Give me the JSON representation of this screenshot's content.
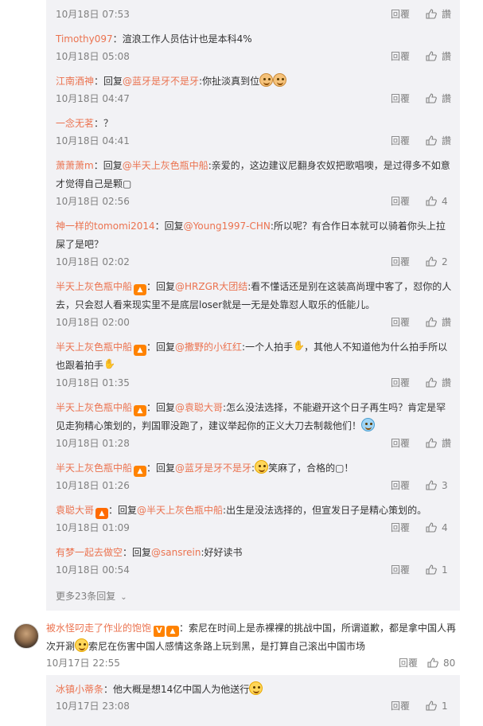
{
  "replies": [
    {
      "id": "r1",
      "time": "10月18日 07:53",
      "reply": "回覆",
      "likes": "讚"
    },
    {
      "id": "r2",
      "user": "Timothy097",
      "text": "：渲浪工作人员估计也是本科4%",
      "time": "10月18日 05:08",
      "reply": "回覆",
      "likes": "讚"
    },
    {
      "id": "r3",
      "user": "江南酒神",
      "prefix": "：回复",
      "at": "@蓝牙是牙不是牙",
      "text": ":你扯淡真到位",
      "time": "10月18日 04:47",
      "reply": "回覆",
      "likes": "讚"
    },
    {
      "id": "r4",
      "user": "一念无茗",
      "text": "：？",
      "time": "10月18日 04:41",
      "reply": "回覆",
      "likes": "讚"
    },
    {
      "id": "r5",
      "user": "萧萧萧m",
      "prefix": "：回复",
      "at": "@半天上灰色瓶中船",
      "text": ":亲爱的，这边建议尼翻身农奴把歌唱噢，是过得多不如意才觉得自己是颗▢",
      "time": "10月18日 02:56",
      "reply": "回覆",
      "likes": "4"
    },
    {
      "id": "r6",
      "user": "神一样的tomomi2014",
      "prefix": "：回复",
      "at": "@Young1997-CHN",
      "text": ":所以呢？有合作日本就可以骑着你头上拉屎了是吧？",
      "time": "10月18日 02:02",
      "reply": "回覆",
      "likes": "2"
    },
    {
      "id": "r7",
      "user": "半天上灰色瓶中船",
      "prefix": "：回复",
      "at": "@HRZGR大团结",
      "text": ":看不懂话还是别在这装高尚理中客了，怼你的人去，只会怼人看来现实里不是底层loser就是一无是处靠怼人取乐的低能儿。",
      "time": "10月18日 02:00",
      "reply": "回覆",
      "likes": "讚"
    },
    {
      "id": "r8",
      "user": "半天上灰色瓶中船",
      "prefix": "：回复",
      "at": "@撒野的小红红",
      "text": ":一个人拍手",
      "text2": "，其他人不知道他为什么拍手所以也跟着拍手",
      "time": "10月18日 01:35",
      "reply": "回覆",
      "likes": "讚"
    },
    {
      "id": "r9",
      "user": "半天上灰色瓶中船",
      "prefix": "：回复",
      "at": "@袁聪大哥",
      "text": ":怎么没法选择，不能避开这个日子再生吗？肯定是罕见走狗精心策划的，判国罪没跑了，建议举起你的正义大刀去制裁他们！",
      "time": "10月18日 01:28",
      "reply": "回覆",
      "likes": "讚"
    },
    {
      "id": "r10",
      "user": "半天上灰色瓶中船",
      "prefix": "：回复",
      "at": "@蓝牙是牙不是牙",
      "text": ":",
      "text2": "笑麻了，合格的▢！",
      "time": "10月18日 01:26",
      "reply": "回覆",
      "likes": "3"
    },
    {
      "id": "r11",
      "user": "袁聪大哥",
      "prefix": "：回复",
      "at": "@半天上灰色瓶中船",
      "text": ":出生是没法选择的，但宣发日子是精心策划的。",
      "time": "10月18日 01:09",
      "reply": "回覆",
      "likes": "4"
    },
    {
      "id": "r12",
      "user": "有梦一起去做空",
      "prefix": "：回复",
      "at": "@sansrein",
      "text": ":好好读书",
      "time": "10月18日 00:54",
      "reply": "回覆",
      "likes": "1"
    }
  ],
  "more_replies": "更多23条回复",
  "main_comment": {
    "user": "被水怪叼走了作业的饱饱",
    "vbadge": "V",
    "text": "：索尼在时间上是赤裸裸的挑战中国，所谓道歉，都是拿中国人再次开涮",
    "text2": "索尼在伤害中国人感情这条路上玩到黑，是打算自己滚出中国市场",
    "time": "10月17日 22:55",
    "reply": "回覆",
    "likes": "80"
  },
  "sub_reply": {
    "user": "冰镇小蒂条",
    "text": "：他大概是想14亿中国人为他送行",
    "time": "10月17日 23:08",
    "reply": "回覆",
    "likes": "1"
  },
  "colors": {
    "link": "#eb7350",
    "meta": "#808080",
    "panel": "#f2f2f5"
  }
}
